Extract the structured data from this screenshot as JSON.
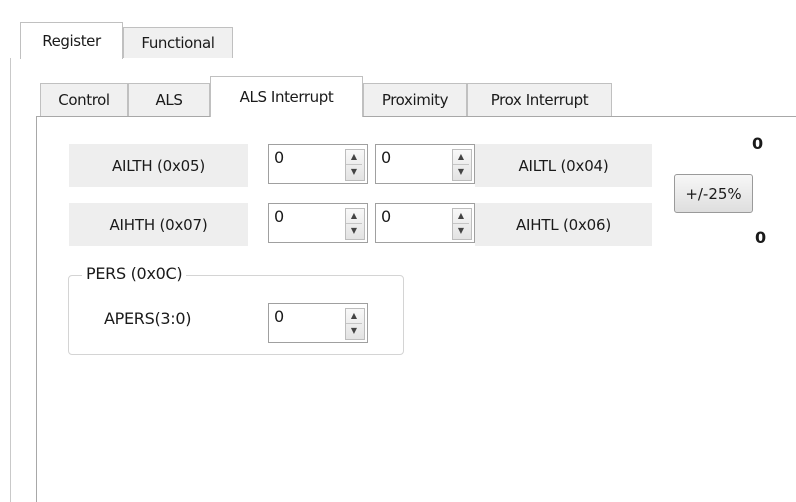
{
  "outer_tabs": [
    {
      "label": "Register",
      "selected": true
    },
    {
      "label": "Functional",
      "selected": false
    }
  ],
  "inner_tabs": [
    {
      "label": "Control",
      "selected": false
    },
    {
      "label": "ALS",
      "selected": false
    },
    {
      "label": "ALS Interrupt",
      "selected": true
    },
    {
      "label": "Proximity",
      "selected": false
    },
    {
      "label": "Prox Interrupt",
      "selected": false
    }
  ],
  "registers": {
    "ailth": {
      "label": "AILTH (0x05)",
      "value": "0"
    },
    "ailtl": {
      "label": "AILTL (0x04)",
      "value": "0"
    },
    "aihth": {
      "label": "AIHTH (0x07)",
      "value": "0"
    },
    "aihtl": {
      "label": "AIHTL (0x06)",
      "value": "0"
    }
  },
  "threshold_button": {
    "label": "+/-25%"
  },
  "readouts": {
    "top": "0",
    "bottom": "0"
  },
  "pers_group": {
    "title": "PERS (0x0C)",
    "apers_label": "APERS(3:0)",
    "apers_value": "0"
  },
  "icons": {
    "spin_up": "triangle-up",
    "spin_down": "triangle-down"
  }
}
